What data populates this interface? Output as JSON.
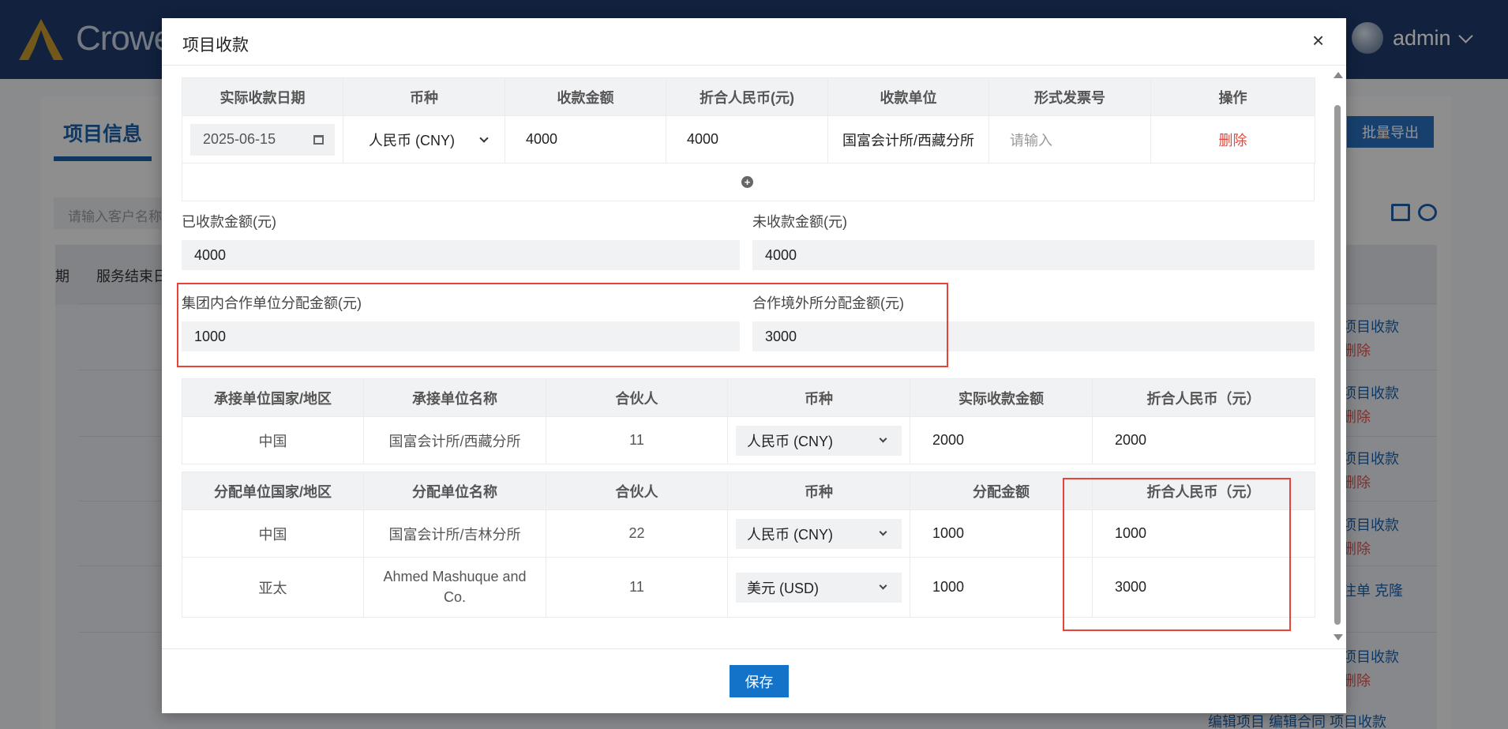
{
  "app": {
    "logo_text": "Crowe",
    "user_name": "admin",
    "tab_title": "项目信息",
    "export_button": "批量导出",
    "search_placeholder": "请输入客户名称",
    "bg_header_col1": "期",
    "bg_header_col2": "服务结束日",
    "bg_actions": [
      {
        "label": "项目收款",
        "sub": "删除"
      },
      {
        "label": "项目收款",
        "sub": "删除"
      },
      {
        "label": "项目收款",
        "sub": "删除"
      },
      {
        "label": "项目收款",
        "sub": "删除"
      },
      {
        "label": "注单  克隆",
        "sub": ""
      },
      {
        "label": "项目收款",
        "sub": "删除"
      }
    ],
    "bg_bottom_actions": "编辑项目  编辑合同  项目收款"
  },
  "modal": {
    "title": "项目收款",
    "close": "×",
    "save_button": "保存",
    "receipt_table": {
      "headers": [
        "实际收款日期",
        "币种",
        "收款金额",
        "折合人民币(元)",
        "收款单位",
        "形式发票号",
        "操作"
      ],
      "row": {
        "date": "2025-06-15",
        "currency": "人民币 (CNY)",
        "amount": "4000",
        "rmb": "4000",
        "unit": "国富会计所/西藏分所",
        "invoice_placeholder": "请输入",
        "action": "删除"
      }
    },
    "received_label": "已收款金额(元)",
    "received_value": "4000",
    "unreceived_label": "未收款金额(元)",
    "unreceived_value": "4000",
    "group_alloc_label": "集团内合作单位分配金额(元)",
    "group_alloc_value": "1000",
    "overseas_alloc_label": "合作境外所分配金额(元)",
    "overseas_alloc_value": "3000",
    "undertake_table": {
      "headers": [
        "承接单位国家/地区",
        "承接单位名称",
        "合伙人",
        "币种",
        "实际收款金额",
        "折合人民币（元）"
      ],
      "rows": [
        {
          "country": "中国",
          "name": "国富会计所/西藏分所",
          "partner": "11",
          "currency": "人民币 (CNY)",
          "amount": "2000",
          "rmb": "2000"
        }
      ]
    },
    "alloc_table": {
      "headers": [
        "分配单位国家/地区",
        "分配单位名称",
        "合伙人",
        "币种",
        "分配金额",
        "折合人民币（元）"
      ],
      "rows": [
        {
          "country": "中国",
          "name": "国富会计所/吉林分所",
          "partner": "22",
          "currency": "人民币 (CNY)",
          "amount": "1000",
          "rmb": "1000"
        },
        {
          "country": "亚太",
          "name": "Ahmed Mashuque and Co.",
          "partner": "11",
          "currency": "美元 (USD)",
          "amount": "1000",
          "rmb": "3000"
        }
      ]
    }
  }
}
